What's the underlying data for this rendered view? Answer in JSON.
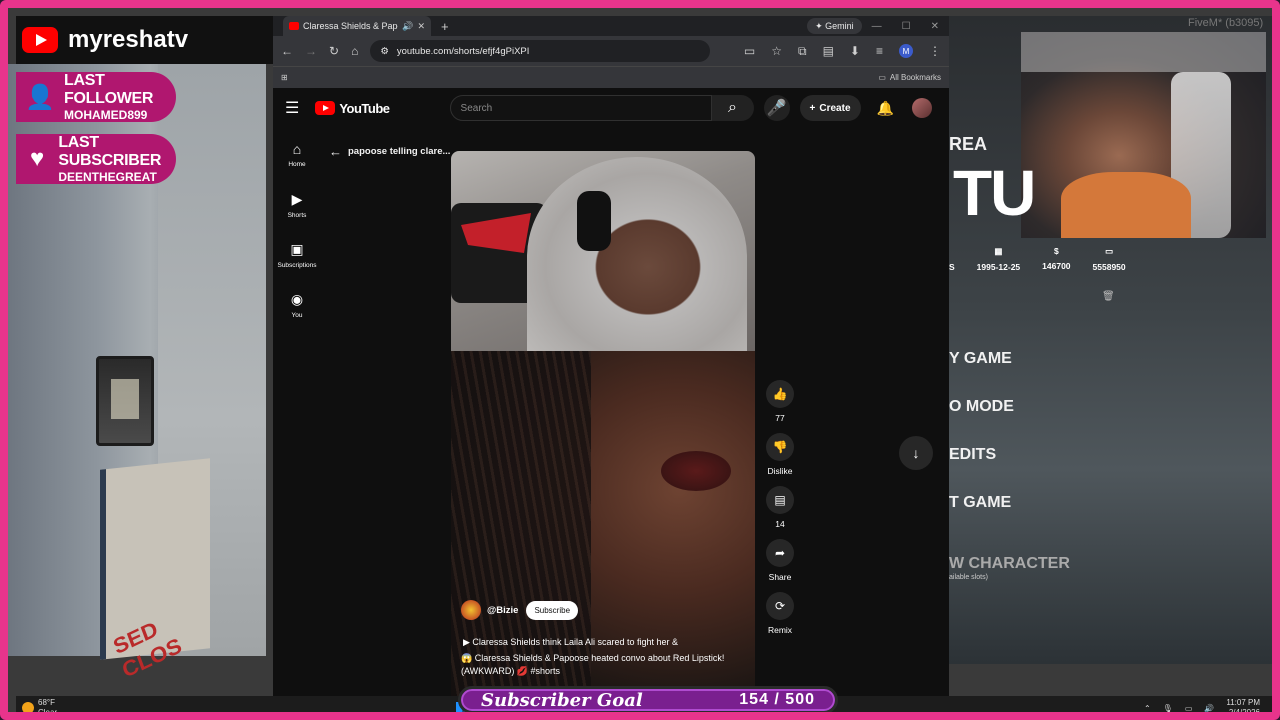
{
  "overlay": {
    "brand_name": "myreshatv",
    "last_follower_label": "LAST FOLLOWER",
    "last_follower_name": "MOHAMED899",
    "last_subscriber_label": "LAST SUBSCRIBER",
    "last_subscriber_name": "DEENTHEGREAT",
    "goal_title": "Subscriber Goal",
    "goal_count": "154 / 500",
    "goal_current": 154,
    "goal_target": 500
  },
  "browser": {
    "tab_title": "Claressa Shields & Papo",
    "gemini_label": "✦ Gemini",
    "url": "youtube.com/shorts/efjf4gPiXPI",
    "bookmarks_label": "All Bookmarks"
  },
  "youtube": {
    "logo_text": "YouTube",
    "search_placeholder": "Search",
    "create_label": "Create",
    "sidebar": [
      {
        "label": "Home",
        "icon": "⌂"
      },
      {
        "label": "Shorts",
        "icon": "▶"
      },
      {
        "label": "Subscriptions",
        "icon": "▣"
      },
      {
        "label": "You",
        "icon": "◉"
      }
    ],
    "back_title": "papoose telling clare...",
    "channel": "@Bizie",
    "subscribe_label": "Subscribe",
    "desc_line1": "▶  Claressa Shields think Laila Ali scared to fight her &",
    "desc_line2": "😱 Claressa Shields & Papoose heated convo about Red Lipstick! (AWKWARD) 💋 #shorts",
    "actions": {
      "like_count": "77",
      "dislike_label": "Dislike",
      "comment_count": "14",
      "share_label": "Share",
      "remix_label": "Remix"
    }
  },
  "game": {
    "cam_tag": "FiveM* (b3095)",
    "area_text": "REA",
    "big_text": "TU",
    "stats": [
      {
        "icon": "▦",
        "value": "1995-12-25"
      },
      {
        "icon": "$",
        "value": "146700"
      },
      {
        "icon": "▭",
        "value": "5558950"
      }
    ],
    "stat_prefix": "S",
    "menu": [
      "Y GAME",
      "O MODE",
      "EDITS",
      "T GAME",
      "W CHARACTER"
    ],
    "slots_text": "ailable slots)"
  },
  "taskbar": {
    "temp": "68°F",
    "condition": "Clear",
    "time": "11:07 PM",
    "date": "2/4/2026"
  }
}
